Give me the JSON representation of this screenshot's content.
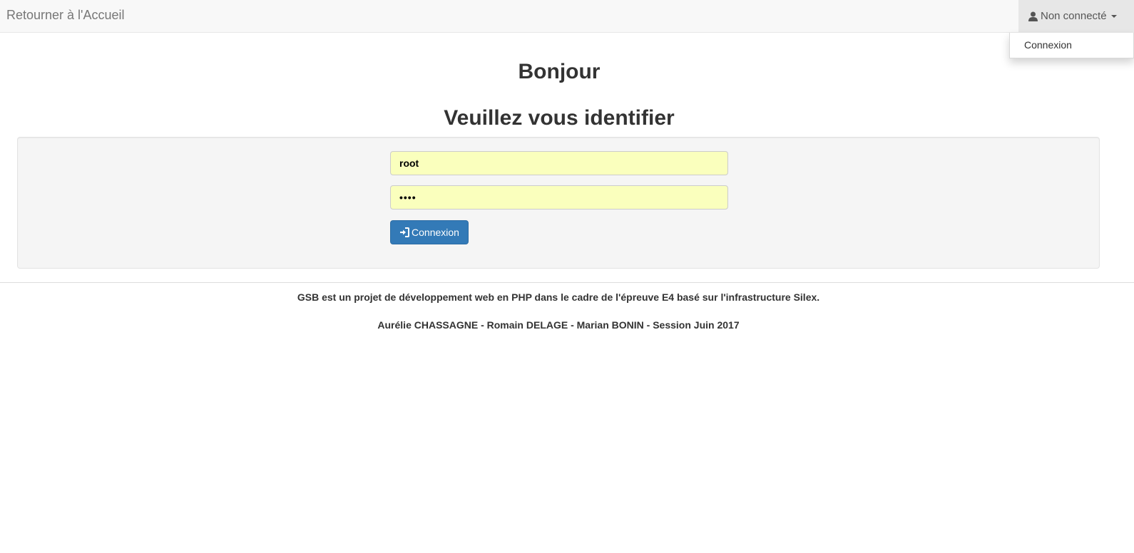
{
  "navbar": {
    "brand": "Retourner à l'Accueil",
    "user_status": "Non connecté",
    "user_icon": "user-icon",
    "dropdown": {
      "items": [
        {
          "label": "Connexion"
        }
      ]
    }
  },
  "main": {
    "greeting": "Bonjour",
    "prompt": "Veuillez vous identifier"
  },
  "login_form": {
    "login_value": "root",
    "password_value": "••••",
    "submit_label": "Connexion",
    "submit_icon": "log-in-icon"
  },
  "footer": {
    "line1": "GSB est un projet de développement web en PHP dans le cadre de l'épreuve E4 basé sur l'infrastructure Silex.",
    "line2": "Aurélie CHASSAGNE - Romain DELAGE - Marian BONIN - Session Juin 2017"
  },
  "colors": {
    "navbar_bg": "#f8f8f8",
    "primary": "#337ab7",
    "autofill": "#faffbd",
    "well_bg": "#f5f5f5"
  }
}
